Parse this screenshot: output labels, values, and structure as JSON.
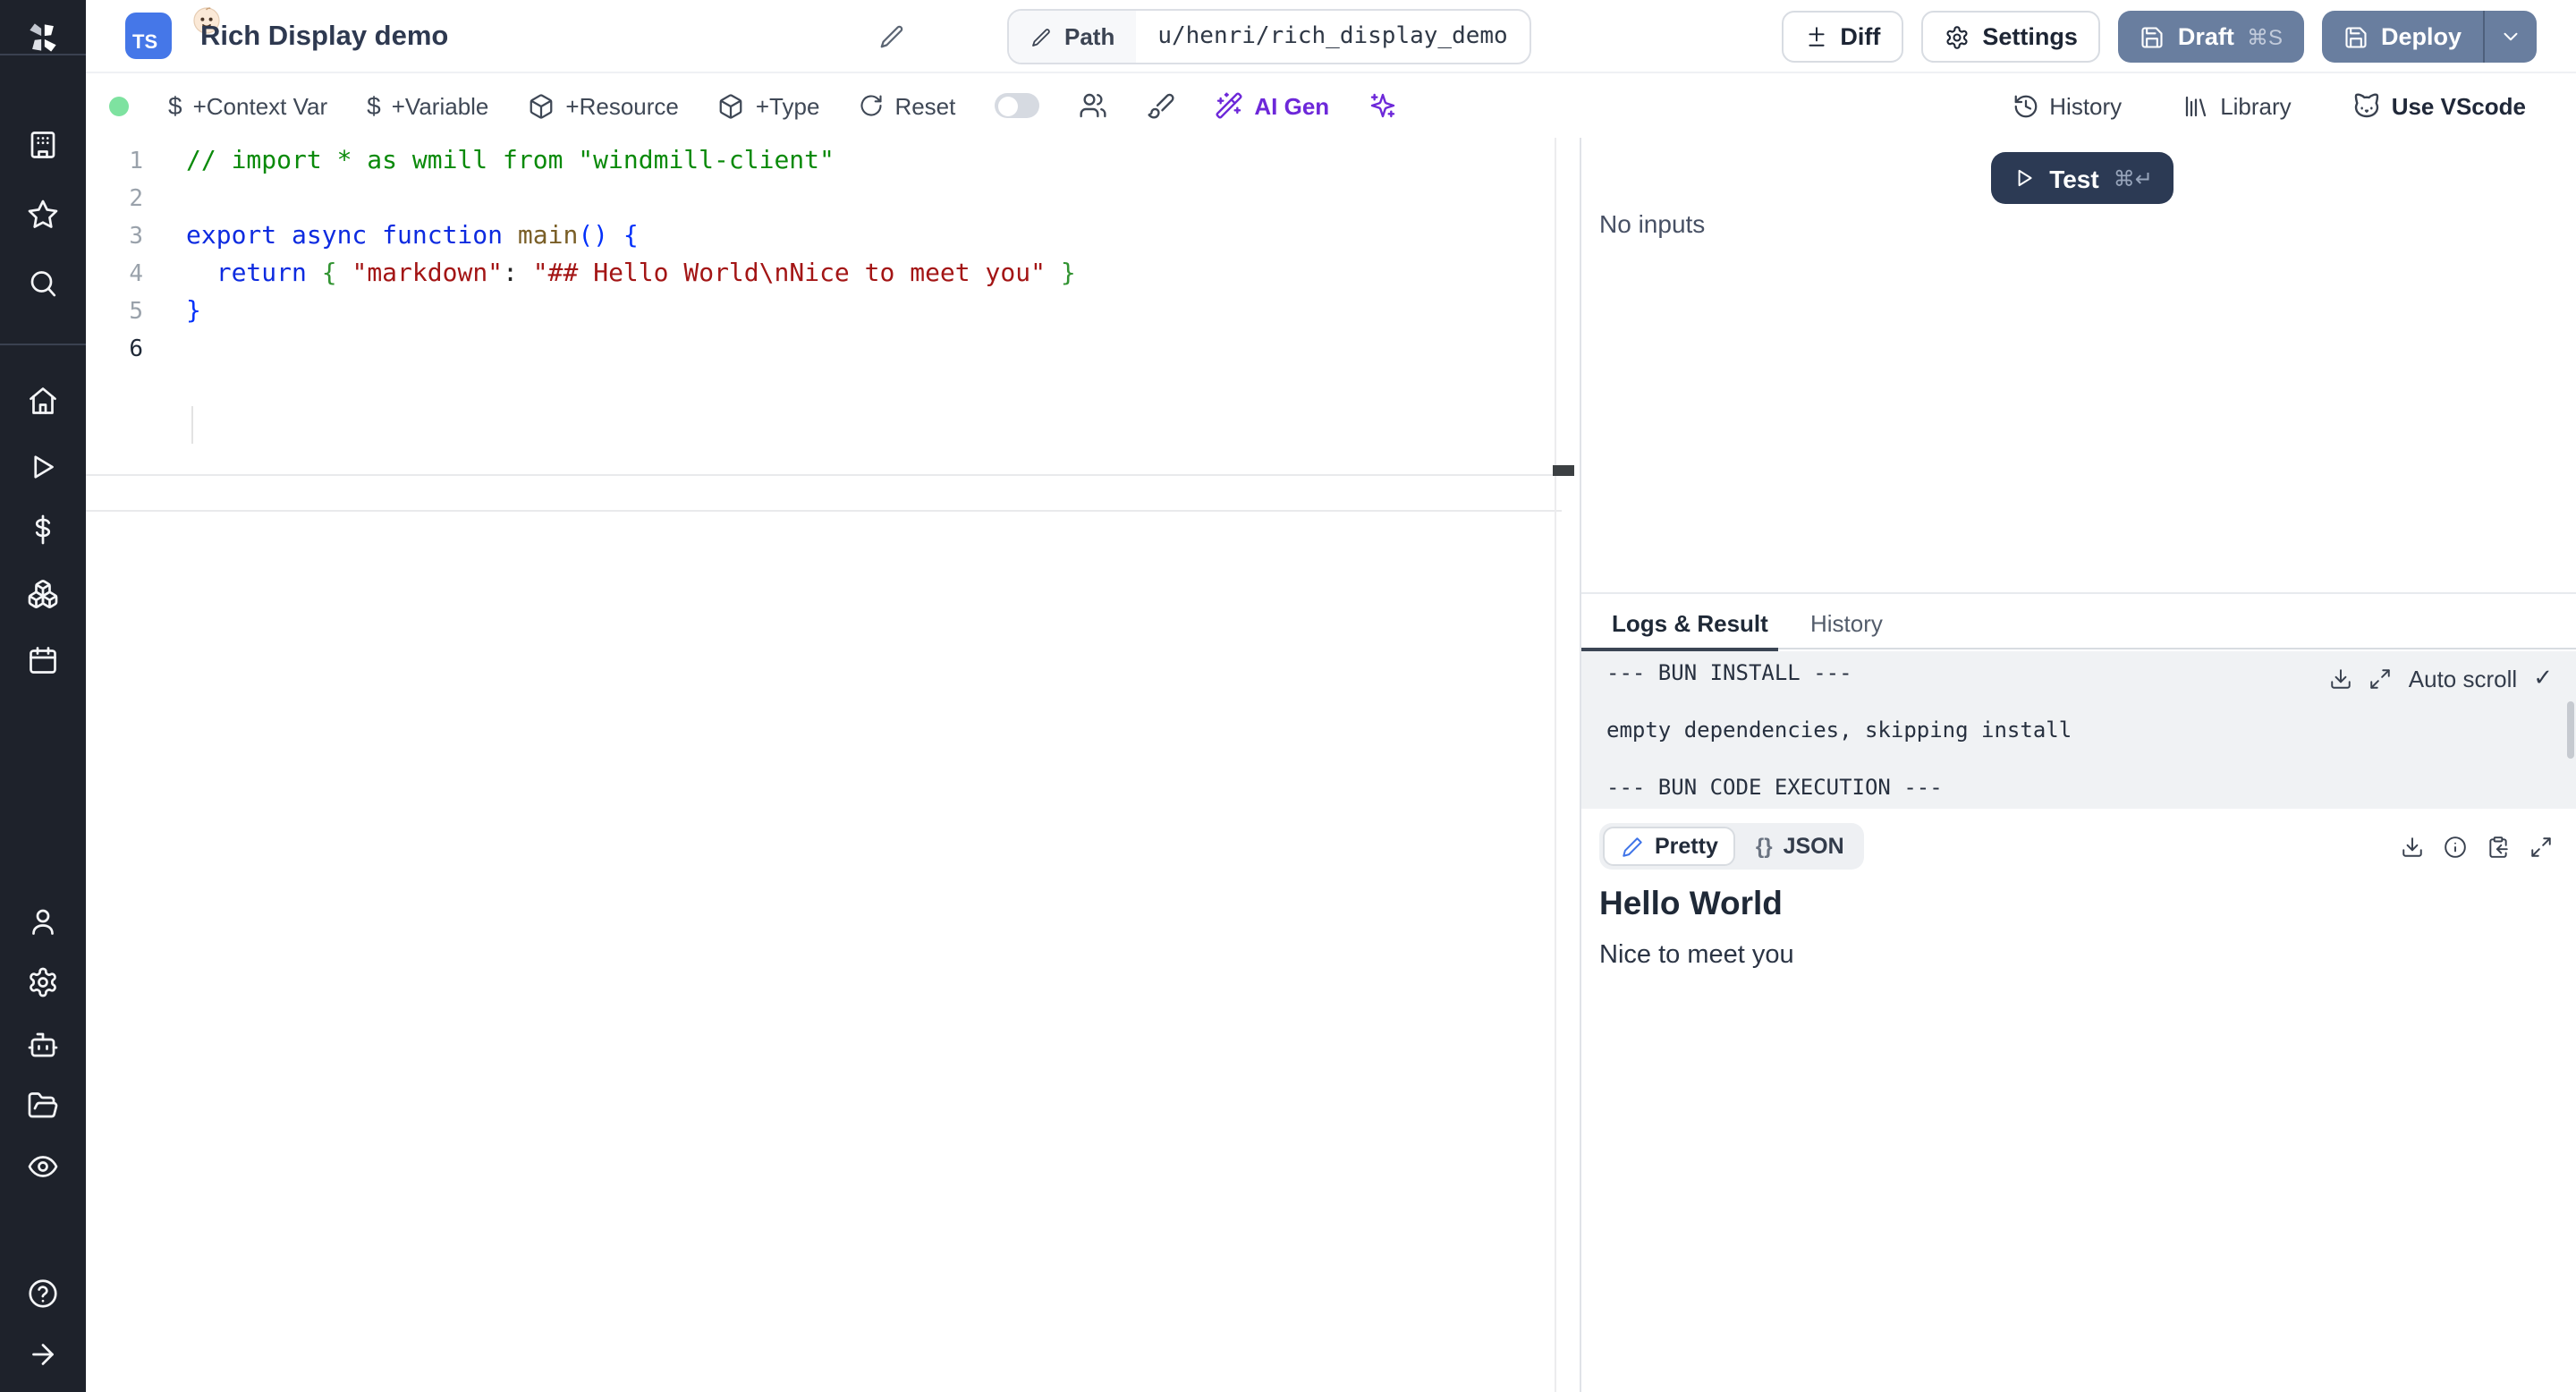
{
  "colors": {
    "sidebar_bg": "#1e222b",
    "ts_badge_blue": "#4577e8",
    "button_slate": "#697e9f",
    "test_navy": "#2c3a54",
    "ai_purple": "#6d28d9",
    "green_status_dot": "#7ee2a0",
    "log_bg": "#f0f2f4"
  },
  "sidebar": {
    "icons": [
      "windmill-logo",
      "building",
      "star",
      "search",
      "home",
      "play",
      "dollar-sign",
      "boxes",
      "calendar",
      "user",
      "settings-gear",
      "bot",
      "folder-open",
      "eye",
      "help-circle",
      "arrow-right"
    ]
  },
  "header": {
    "badge": "TS",
    "badge_emoji": "👶",
    "title": "Rich Display demo",
    "path_label": "Path",
    "path_value": "u/henri/rich_display_demo",
    "diff_label": "Diff",
    "settings_label": "Settings",
    "draft_label": "Draft",
    "draft_shortcut": "⌘S",
    "deploy_label": "Deploy"
  },
  "toolbar": {
    "context_var": "+Context Var",
    "variable": "+Variable",
    "resource": "+Resource",
    "type": "+Type",
    "reset": "Reset",
    "ai_gen": "AI Gen",
    "history": "History",
    "library": "Library",
    "vscode": "Use VScode",
    "dollar": "$"
  },
  "editor": {
    "lines": [
      {
        "num": 1,
        "active": false,
        "segments": [
          {
            "c": "com",
            "t": "// import * as wmill from \"windmill-client\""
          }
        ]
      },
      {
        "num": 2,
        "active": false,
        "segments": []
      },
      {
        "num": 3,
        "active": false,
        "segments": [
          {
            "c": "kw",
            "t": "export async function "
          },
          {
            "c": "fn",
            "t": "main"
          },
          {
            "c": "br0",
            "t": "() {"
          }
        ]
      },
      {
        "num": 4,
        "active": false,
        "segments": [
          {
            "c": "pl",
            "t": "  "
          },
          {
            "c": "kw",
            "t": "return"
          },
          {
            "c": "pl",
            "t": " "
          },
          {
            "c": "br1",
            "t": "{ "
          },
          {
            "c": "str",
            "t": "\"markdown\""
          },
          {
            "c": "pl",
            "t": ": "
          },
          {
            "c": "str",
            "t": "\"## Hello World\\nNice to meet you\""
          },
          {
            "c": "pl",
            "t": " "
          },
          {
            "c": "br1",
            "t": "}"
          }
        ]
      },
      {
        "num": 5,
        "active": false,
        "segments": [
          {
            "c": "br0",
            "t": "}"
          }
        ]
      },
      {
        "num": 6,
        "active": true,
        "segments": []
      }
    ]
  },
  "right_panel": {
    "test_label": "Test",
    "test_shortcut": "⌘↵",
    "no_inputs": "No inputs",
    "tabs": {
      "active": "Logs & Result",
      "inactive": "History"
    },
    "logs": [
      "--- BUN INSTALL ---",
      "empty dependencies, skipping install",
      "--- BUN CODE EXECUTION ---"
    ],
    "auto_scroll_label": "Auto scroll",
    "auto_scroll_check": "✓",
    "pretty_label": "Pretty",
    "json_label": "JSON",
    "json_brace_glyph": "{}",
    "result_heading": "Hello World",
    "result_text": "Nice to meet you"
  }
}
